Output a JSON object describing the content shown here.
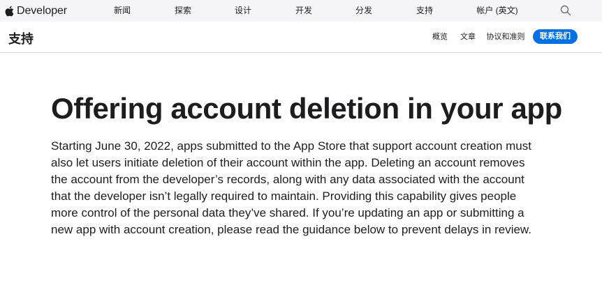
{
  "globalnav": {
    "brand": "Developer",
    "items": [
      "新闻",
      "探索",
      "设计",
      "开发",
      "分发",
      "支持",
      "帐户 (英文)"
    ],
    "search_icon": "search-icon"
  },
  "localnav": {
    "title": "支持",
    "links": [
      "概览",
      "文章",
      "协议和准则"
    ],
    "cta": "联系我们"
  },
  "article": {
    "title": "Offering account deletion in your app",
    "intro": "Starting June 30, 2022, apps submitted to the App Store that support account creation must also let users initiate deletion of their account within the app. Deleting an account removes the account from the developer’s records, along with any data associated with the account that the developer isn’t legally required to maintain. Providing this capability gives people more control of the personal data they’ve shared. If you’re updating an app or submitting a new app with account creation, please read the guidance below to prevent delays in review."
  },
  "colors": {
    "accent": "#0071e3",
    "nav_bg": "#f5f5f7",
    "text": "#1d1d1f"
  }
}
